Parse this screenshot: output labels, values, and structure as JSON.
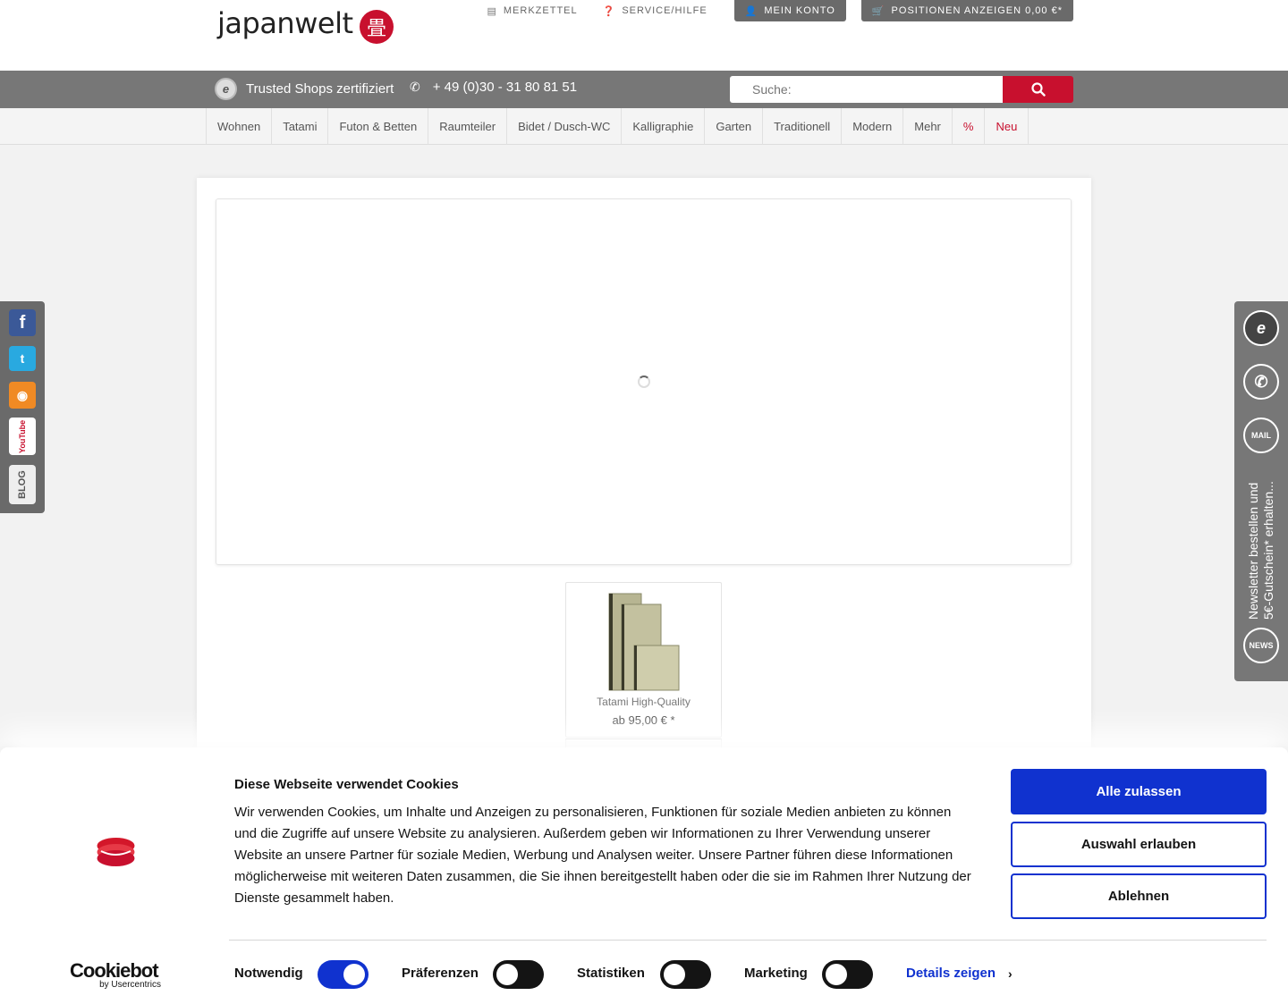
{
  "header": {
    "logo_text": "japanwelt",
    "top_links": [
      {
        "label": "MERKZETTEL",
        "icon": "document-icon"
      },
      {
        "label": "SERVICE/HILFE",
        "icon": "question-icon"
      }
    ],
    "account_label": "MEIN KONTO",
    "cart_label": "POSITIONEN ANZEIGEN 0,00 €*"
  },
  "bar": {
    "trusted_label": "Trusted Shops zertifiziert",
    "phone": "+ 49 (0)30 - 31 80 81 51",
    "search_placeholder": "Suche:"
  },
  "nav": {
    "items": [
      "Wohnen",
      "Tatami",
      "Futon & Betten",
      "Raumteiler",
      "Bidet / Dusch-WC",
      "Kalligraphie",
      "Garten",
      "Traditionell",
      "Modern",
      "Mehr",
      "%",
      "Neu"
    ]
  },
  "product": {
    "name": "Tatami High-Quality",
    "price": "ab 95,00 € *"
  },
  "right_panel": {
    "newsletter_text": "Newsletter bestellen und 5€-Gutschein* erhalten...",
    "mail_label": "MAIL",
    "news_label": "NEWS"
  },
  "cookie": {
    "title": "Diese Webseite verwendet Cookies",
    "text": "Wir verwenden Cookies, um Inhalte und Anzeigen zu personalisieren, Funktionen für soziale Medien anbieten zu können und die Zugriffe auf unsere Website zu analysieren. Außerdem geben wir Informationen zu Ihrer Verwendung unserer Website an unsere Partner für soziale Medien, Werbung und Analysen weiter. Unsere Partner führen diese Informationen möglicherweise mit weiteren Daten zusammen, die Sie ihnen bereitgestellt haben oder die sie im Rahmen Ihrer Nutzung der Dienste gesammelt haben.",
    "btn_allow_all": "Alle zulassen",
    "btn_allow_selection": "Auswahl erlauben",
    "btn_decline": "Ablehnen",
    "toggles": [
      {
        "label": "Notwendig",
        "on": true
      },
      {
        "label": "Präferenzen",
        "on": false
      },
      {
        "label": "Statistiken",
        "on": false
      },
      {
        "label": "Marketing",
        "on": false
      }
    ],
    "details_label": "Details zeigen",
    "brand_main": "Cookiebot",
    "brand_sub": "by Usercentrics",
    "accent_color": "#1032cf"
  },
  "colors": {
    "brand_red": "#c8102e",
    "bar_gray": "#777777"
  }
}
